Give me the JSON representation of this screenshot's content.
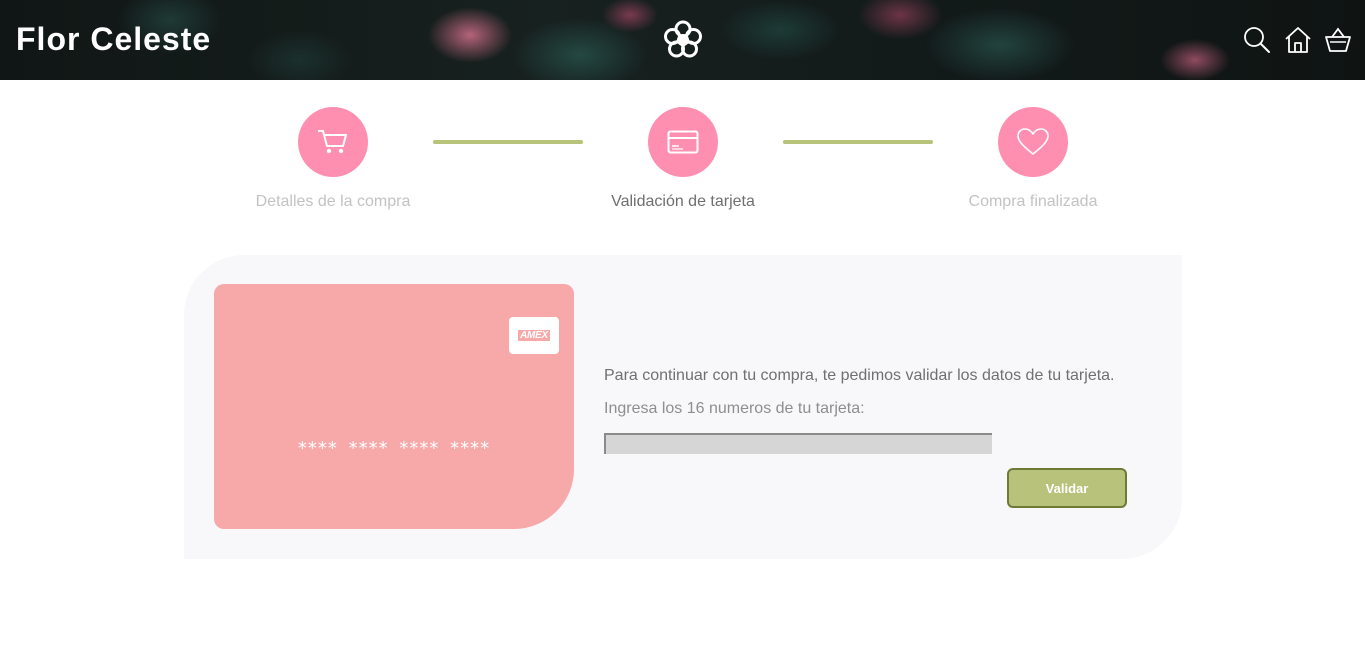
{
  "header": {
    "brand": "Flor Celeste",
    "icons": [
      "flower-logo-icon",
      "search-icon",
      "home-icon",
      "basket-icon"
    ]
  },
  "stepper": {
    "steps": [
      {
        "label": "Detalles de la compra",
        "icon": "cart-icon",
        "state": "done"
      },
      {
        "label": "Validación de tarjeta",
        "icon": "credit-card-icon",
        "state": "active"
      },
      {
        "label": "Compra finalizada",
        "icon": "heart-icon",
        "state": "pending"
      }
    ]
  },
  "card": {
    "brand_badge": "AMEX",
    "number_mask": "**** **** **** ****"
  },
  "form": {
    "instruction": "Para continuar con tu compra, te pedimos validar los datos de tu tarjeta.",
    "prompt": "Ingresa los 16 numeros de tu tarjeta:",
    "input_value": "",
    "button_label": "Validar"
  },
  "colors": {
    "accent_pink": "#fe8fb0",
    "card_pink": "#f7a8a8",
    "accent_green": "#b7c27a",
    "panel_bg": "#f8f8fa"
  }
}
